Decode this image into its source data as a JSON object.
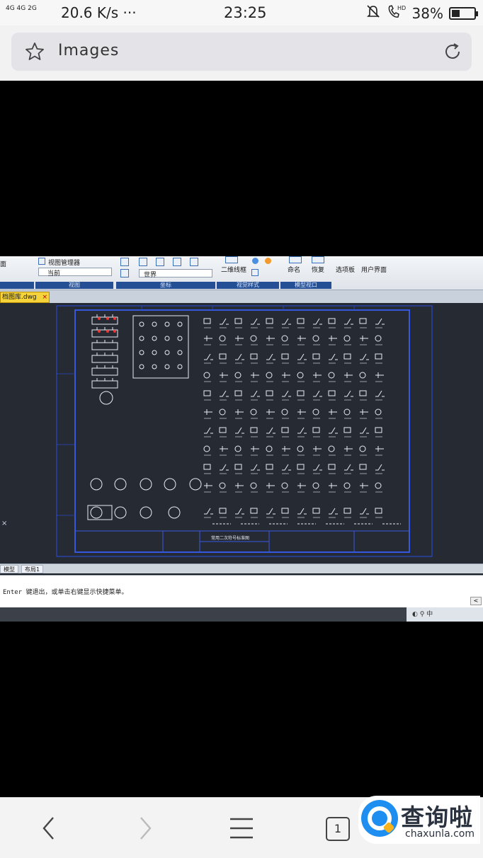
{
  "status_bar": {
    "network": "4G 4G  2G",
    "speed": "20.6 K/s ···",
    "time": "23:25",
    "battery_percent_label": "38%",
    "battery_level": 0.38
  },
  "browser": {
    "url_text": "Images"
  },
  "cad": {
    "ribbon": {
      "view_manager": "视图管理器",
      "current": "当前",
      "world": "世界",
      "wireframe_2d": "二维线框",
      "name": "命名",
      "restore": "恢复",
      "options_panel": "选项板",
      "user_interface": "用户界面",
      "panel_labels": [
        "视图",
        "坐标",
        "视觉样式",
        "模型视口"
      ],
      "left_cut": "面"
    },
    "doc_tab": "档图库.dwg",
    "title_block": "常用二次符号标准图",
    "layout_tabs": [
      "模型",
      "布局1"
    ],
    "command_line": "Enter 键退出，或单击右键显示快捷菜单。",
    "tray_text": "中"
  },
  "bottom_nav": {
    "tab_count": "1"
  },
  "watermark": {
    "cn": "查询啦",
    "en": "chaxunla.com"
  },
  "colors": {
    "cad_background": "#262b33",
    "ribbon_panel_blue": "#254f95",
    "drawing_border_blue": "#2a47c8",
    "watermark_blue": "#1e8ef0",
    "doc_tab_yellow": "#f5d33a"
  }
}
